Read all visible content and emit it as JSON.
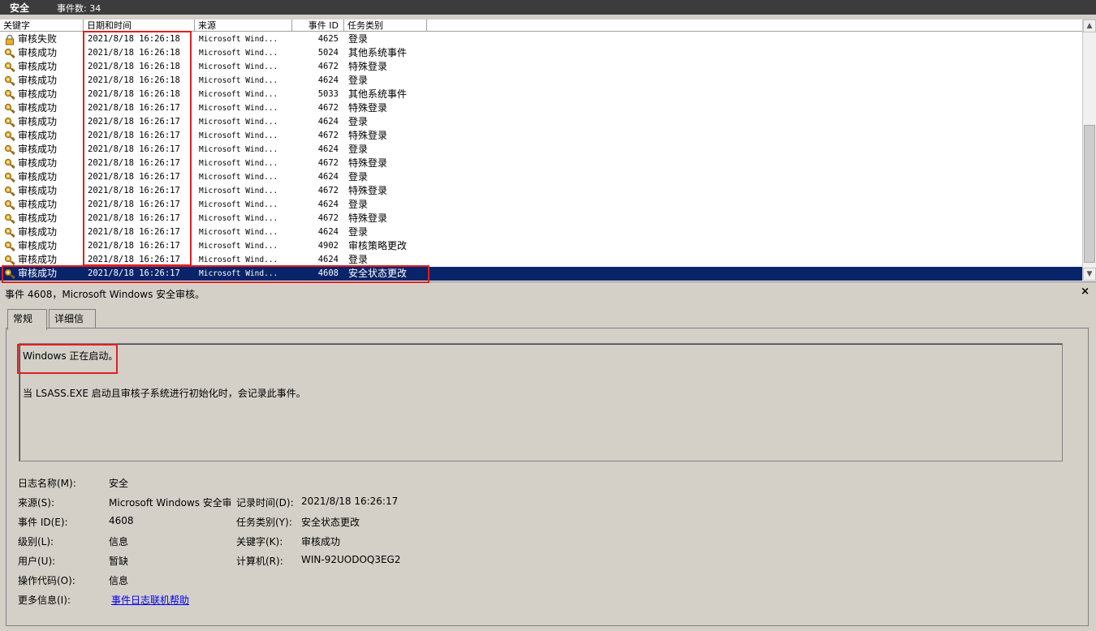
{
  "titlebar": {
    "name": "安全",
    "count": "事件数: 34"
  },
  "columns": [
    "关键字",
    "日期和时间",
    "来源",
    "事件 ID",
    "任务类别"
  ],
  "events": [
    {
      "keyword": "审核失败",
      "datetime": "2021/8/18 16:26:18",
      "source": "Microsoft Wind...",
      "id": "4625",
      "category": "登录",
      "icon": "lock-icon"
    },
    {
      "keyword": "审核成功",
      "datetime": "2021/8/18 16:26:18",
      "source": "Microsoft Wind...",
      "id": "5024",
      "category": "其他系统事件",
      "icon": "key-icon"
    },
    {
      "keyword": "审核成功",
      "datetime": "2021/8/18 16:26:18",
      "source": "Microsoft Wind...",
      "id": "4672",
      "category": "特殊登录",
      "icon": "key-icon"
    },
    {
      "keyword": "审核成功",
      "datetime": "2021/8/18 16:26:18",
      "source": "Microsoft Wind...",
      "id": "4624",
      "category": "登录",
      "icon": "key-icon"
    },
    {
      "keyword": "审核成功",
      "datetime": "2021/8/18 16:26:18",
      "source": "Microsoft Wind...",
      "id": "5033",
      "category": "其他系统事件",
      "icon": "key-icon"
    },
    {
      "keyword": "审核成功",
      "datetime": "2021/8/18 16:26:17",
      "source": "Microsoft Wind...",
      "id": "4672",
      "category": "特殊登录",
      "icon": "key-icon"
    },
    {
      "keyword": "审核成功",
      "datetime": "2021/8/18 16:26:17",
      "source": "Microsoft Wind...",
      "id": "4624",
      "category": "登录",
      "icon": "key-icon"
    },
    {
      "keyword": "审核成功",
      "datetime": "2021/8/18 16:26:17",
      "source": "Microsoft Wind...",
      "id": "4672",
      "category": "特殊登录",
      "icon": "key-icon"
    },
    {
      "keyword": "审核成功",
      "datetime": "2021/8/18 16:26:17",
      "source": "Microsoft Wind...",
      "id": "4624",
      "category": "登录",
      "icon": "key-icon"
    },
    {
      "keyword": "审核成功",
      "datetime": "2021/8/18 16:26:17",
      "source": "Microsoft Wind...",
      "id": "4672",
      "category": "特殊登录",
      "icon": "key-icon"
    },
    {
      "keyword": "审核成功",
      "datetime": "2021/8/18 16:26:17",
      "source": "Microsoft Wind...",
      "id": "4624",
      "category": "登录",
      "icon": "key-icon"
    },
    {
      "keyword": "审核成功",
      "datetime": "2021/8/18 16:26:17",
      "source": "Microsoft Wind...",
      "id": "4672",
      "category": "特殊登录",
      "icon": "key-icon"
    },
    {
      "keyword": "审核成功",
      "datetime": "2021/8/18 16:26:17",
      "source": "Microsoft Wind...",
      "id": "4624",
      "category": "登录",
      "icon": "key-icon"
    },
    {
      "keyword": "审核成功",
      "datetime": "2021/8/18 16:26:17",
      "source": "Microsoft Wind...",
      "id": "4672",
      "category": "特殊登录",
      "icon": "key-icon"
    },
    {
      "keyword": "审核成功",
      "datetime": "2021/8/18 16:26:17",
      "source": "Microsoft Wind...",
      "id": "4624",
      "category": "登录",
      "icon": "key-icon"
    },
    {
      "keyword": "审核成功",
      "datetime": "2021/8/18 16:26:17",
      "source": "Microsoft Wind...",
      "id": "4902",
      "category": "审核策略更改",
      "icon": "key-icon"
    },
    {
      "keyword": "审核成功",
      "datetime": "2021/8/18 16:26:17",
      "source": "Microsoft Wind...",
      "id": "4624",
      "category": "登录",
      "icon": "key-icon"
    },
    {
      "keyword": "审核成功",
      "datetime": "2021/8/18 16:26:17",
      "source": "Microsoft Wind...",
      "id": "4608",
      "category": "安全状态更改",
      "icon": "key-icon",
      "selected": true
    }
  ],
  "detail": {
    "title": "事件 4608，Microsoft Windows 安全审核。",
    "close": "×",
    "tabs": [
      "常规",
      "详细信息"
    ],
    "line1": "Windows 正在启动。",
    "line2": "当 LSASS.EXE 启动且审核子系统进行初始化时，会记录此事件。",
    "props_left": [
      {
        "label": "日志名称(M):",
        "value": "安全"
      },
      {
        "label": "来源(S):",
        "value": "Microsoft Windows 安全审核"
      },
      {
        "label": "事件 ID(E):",
        "value": "4608"
      },
      {
        "label": "级别(L):",
        "value": "信息"
      },
      {
        "label": "用户(U):",
        "value": "暂缺"
      },
      {
        "label": "操作代码(O):",
        "value": "信息"
      },
      {
        "label": "更多信息(I):",
        "value": "事件日志联机帮助"
      }
    ],
    "props_right": [
      {
        "label": "记录时间(D):",
        "value": "2021/8/18 16:26:17"
      },
      {
        "label": "任务类别(Y):",
        "value": "安全状态更改"
      },
      {
        "label": "关键字(K):",
        "value": "审核成功"
      },
      {
        "label": "计算机(R):",
        "value": "WIN-92UODOQ3EG2"
      }
    ]
  },
  "colors": {
    "selection": "#0a246a",
    "highlight": "#e02020",
    "link": "#0000ee"
  }
}
